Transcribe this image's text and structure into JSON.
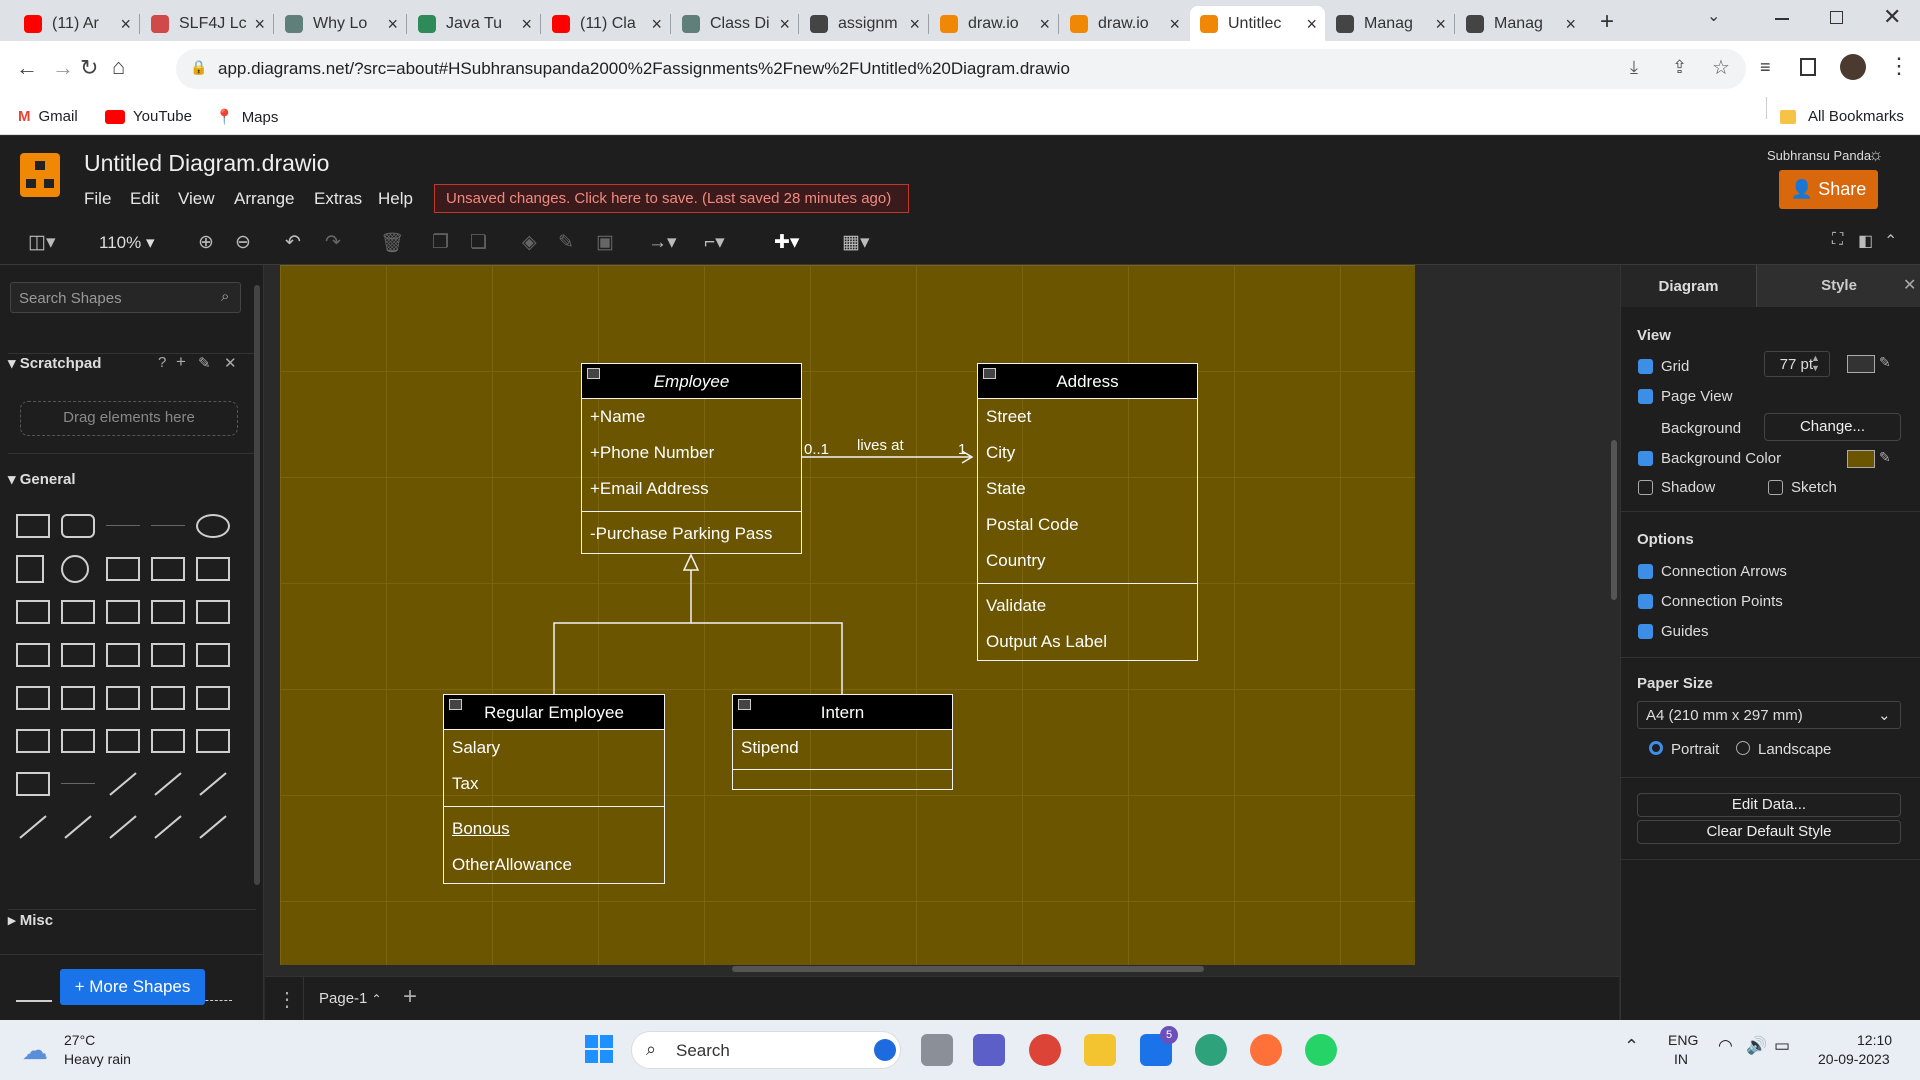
{
  "browser": {
    "tabs": [
      {
        "label": "(11) Ar",
        "color": "#ff0000"
      },
      {
        "label": "SLF4J Lc",
        "color": "#d04a4a"
      },
      {
        "label": "Why Lo",
        "color": "#5f7f7a"
      },
      {
        "label": "Java Tu",
        "color": "#2e8b57"
      },
      {
        "label": "(11) Cla",
        "color": "#ff0000"
      },
      {
        "label": "Class Di",
        "color": "#5f7f7a"
      },
      {
        "label": "assignm",
        "color": "#444444"
      },
      {
        "label": "draw.io",
        "color": "#f08705"
      },
      {
        "label": "draw.io",
        "color": "#f08705"
      },
      {
        "label": "Untitlec",
        "color": "#f08705"
      },
      {
        "label": "Manag",
        "color": "#444444"
      },
      {
        "label": "Manag",
        "color": "#444444"
      }
    ],
    "url": "app.diagrams.net/?src=about#HSubhransupanda2000%2Fassignments%2Fnew%2FUntitled%20Diagram.drawio",
    "bookmarks": [
      "Gmail",
      "YouTube",
      "Maps"
    ],
    "all_bookmarks": "All Bookmarks"
  },
  "app": {
    "title": "Untitled Diagram.drawio",
    "menus": [
      "File",
      "Edit",
      "View",
      "Arrange",
      "Extras",
      "Help"
    ],
    "unsaved_notice": "Unsaved changes. Click here to save. (Last saved 28 minutes ago)",
    "user": "Subhransu Panda",
    "share_label": "Share",
    "zoom": "110%"
  },
  "left_panel": {
    "search_placeholder": "Search Shapes",
    "scratchpad_title": "Scratchpad",
    "scratchpad_hint": "Drag elements here",
    "general_title": "General",
    "misc_title": "Misc",
    "more_shapes": "+ More Shapes"
  },
  "diagram": {
    "employee": {
      "name": "Employee",
      "attrs": [
        "+Name",
        "+Phone Number",
        "+Email Address"
      ],
      "methods": [
        "-Purchase Parking Pass"
      ]
    },
    "address": {
      "name": "Address",
      "attrs": [
        "Street",
        "City",
        "State",
        "Postal Code",
        "Country"
      ],
      "methods": [
        "Validate",
        "Output As Label"
      ]
    },
    "regular": {
      "name": "Regular Employee",
      "attrs": [
        "Salary",
        "Tax"
      ],
      "methods": [
        "Bonous",
        "OtherAllowance"
      ]
    },
    "intern": {
      "name": "Intern",
      "attrs": [
        "Stipend"
      ]
    },
    "association": {
      "label": "lives at",
      "source_mult": "0..1",
      "target_mult": "1"
    }
  },
  "page_tabs": {
    "current": "Page-1"
  },
  "right_panel": {
    "tabs": [
      "Diagram",
      "Style"
    ],
    "view_title": "View",
    "grid": "Grid",
    "grid_size": "77 pt",
    "page_view": "Page View",
    "background": "Background",
    "change": "Change...",
    "background_color": "Background Color",
    "bg_color_value": "#6b5501",
    "shadow": "Shadow",
    "sketch": "Sketch",
    "options_title": "Options",
    "connection_arrows": "Connection Arrows",
    "connection_points": "Connection Points",
    "guides": "Guides",
    "paper_size_title": "Paper Size",
    "paper_size": "A4 (210 mm x 297 mm)",
    "portrait": "Portrait",
    "landscape": "Landscape",
    "edit_data": "Edit Data...",
    "clear_style": "Clear Default Style"
  },
  "taskbar": {
    "temp": "27°C",
    "weather": "Heavy rain",
    "search": "Search",
    "lang1": "ENG",
    "lang2": "IN",
    "time": "12:10",
    "date": "20-09-2023",
    "mail_badge": "5"
  }
}
